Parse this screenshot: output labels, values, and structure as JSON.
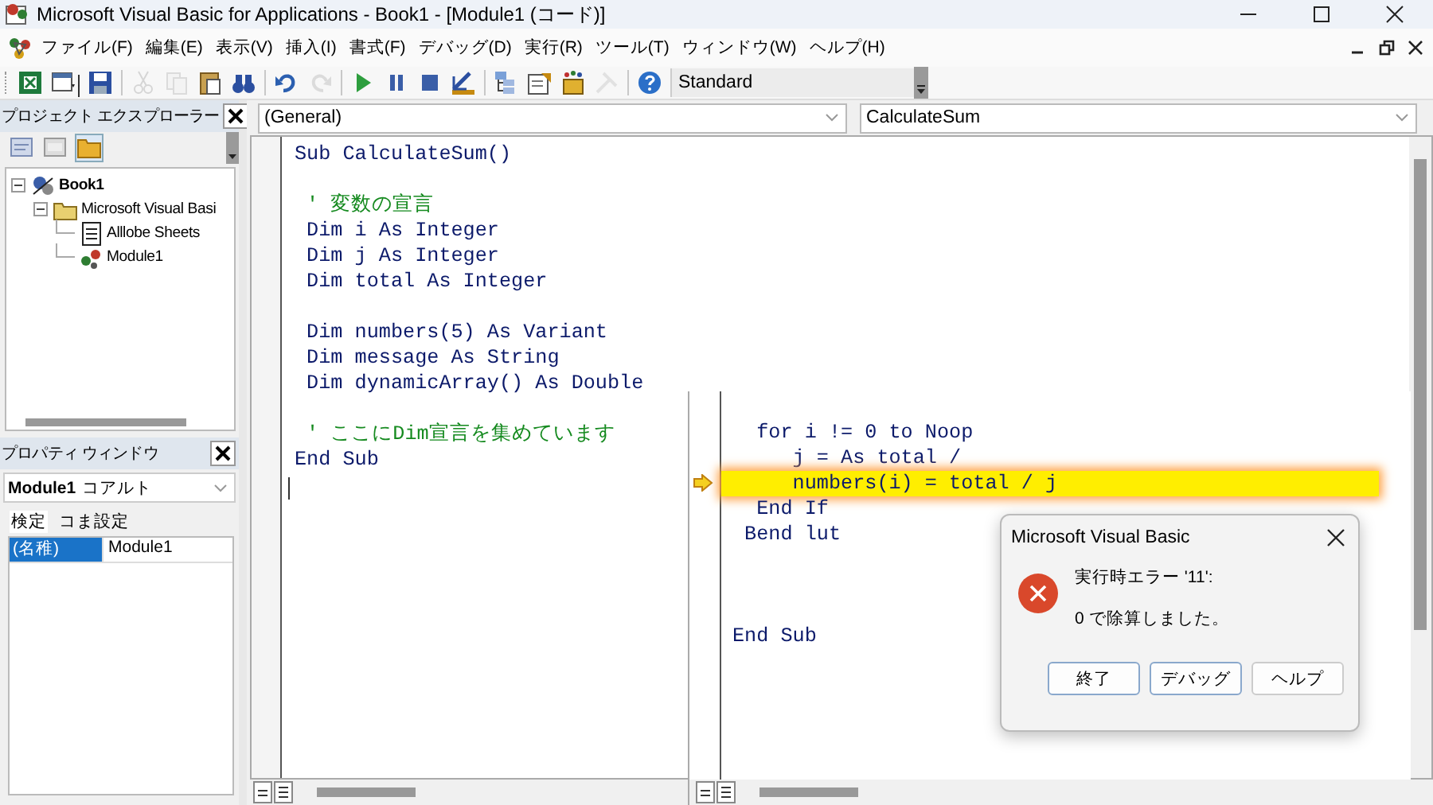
{
  "window": {
    "title": "Microsoft Visual Basic for Applications - Book1 - [Module1 (コード)]"
  },
  "menu": [
    "ファイル(F)",
    "編集(E)",
    "表示(V)",
    "挿入(I)",
    "書式(F)",
    "デバッグ(D)",
    "実行(R)",
    "ツール(T)",
    "ウィンドウ(W)",
    "ヘルプ(H)"
  ],
  "toolbar": {
    "buttons": [
      {
        "kind": "excel",
        "disabled": false
      },
      {
        "kind": "form",
        "disabled": false
      },
      {
        "kind": "save",
        "disabled": false
      },
      {
        "kind": "separator"
      },
      {
        "kind": "cut",
        "disabled": true
      },
      {
        "kind": "copy",
        "disabled": true
      },
      {
        "kind": "paste",
        "disabled": false
      },
      {
        "kind": "find",
        "disabled": false
      },
      {
        "kind": "separator"
      },
      {
        "kind": "undo",
        "disabled": false
      },
      {
        "kind": "redo",
        "disabled": true
      },
      {
        "kind": "separator"
      },
      {
        "kind": "run",
        "disabled": false
      },
      {
        "kind": "pause",
        "disabled": false
      },
      {
        "kind": "stop",
        "disabled": false
      },
      {
        "kind": "design",
        "disabled": false
      },
      {
        "kind": "separator"
      },
      {
        "kind": "project",
        "disabled": false
      },
      {
        "kind": "properties",
        "disabled": false
      },
      {
        "kind": "objects",
        "disabled": false
      },
      {
        "kind": "toolbox",
        "disabled": true
      },
      {
        "kind": "separator"
      },
      {
        "kind": "help",
        "disabled": false
      }
    ],
    "combo": "Standard"
  },
  "project_explorer": {
    "title": "プロジェクト エクスプローラー",
    "buttons": [
      {
        "kind": "code",
        "selected": false
      },
      {
        "kind": "object",
        "selected": false
      },
      {
        "kind": "folders",
        "selected": true
      }
    ],
    "tree": [
      {
        "label": "Book1",
        "kind": "project",
        "expanded": true,
        "children": [
          {
            "label": "Microsoft Visual Basi",
            "kind": "folder",
            "expanded": true,
            "children": [
              {
                "label": "Alllobe Sheets",
                "kind": "sheet"
              },
              {
                "label": "Module1",
                "kind": "module"
              }
            ]
          }
        ]
      }
    ]
  },
  "properties": {
    "title": "プロパティ ウィンドウ",
    "object_name": "Module1",
    "object_type": "コアルト",
    "tabs": [
      {
        "label": "検定",
        "selected": true
      },
      {
        "label": "コま設定",
        "selected": false
      }
    ],
    "rows": [
      {
        "name": "(名稚)",
        "value": "Module1",
        "selected": true
      }
    ]
  },
  "code_window": {
    "object": "(General)",
    "procedure": "CalculateSum",
    "lines": [
      {
        "kind": "code",
        "text": "Sub CalculateSum()"
      },
      {
        "kind": "blank"
      },
      {
        "kind": "comment",
        "text": " ' 変数の宣言"
      },
      {
        "kind": "code",
        "text": " Dim i As Integer"
      },
      {
        "kind": "code",
        "text": " Dim j As Integer"
      },
      {
        "kind": "code",
        "text": " Dim total As Integer"
      },
      {
        "kind": "blank"
      },
      {
        "kind": "code",
        "text": " Dim numbers(5) As Variant"
      },
      {
        "kind": "code",
        "text": " Dim message As String"
      },
      {
        "kind": "code",
        "text": " Dim dynamicArray() As Double"
      },
      {
        "kind": "blank"
      },
      {
        "kind": "comment",
        "text": " ' ここにDim宣言を集めています"
      },
      {
        "kind": "code",
        "text": "End Sub"
      }
    ],
    "second_pane": [
      {
        "kind": "code",
        "text": "  for i != 0 to Noop",
        "current": false
      },
      {
        "kind": "code",
        "text": "     j = As total /",
        "current": false
      },
      {
        "kind": "code",
        "text": "     numbers(i) = total / j",
        "current": true
      },
      {
        "kind": "code",
        "text": "  End If",
        "current": false
      },
      {
        "kind": "code",
        "text": " Bend lut",
        "current": false
      },
      {
        "kind": "blank",
        "current": false
      },
      {
        "kind": "blank",
        "current": false
      },
      {
        "kind": "blank",
        "current": false
      },
      {
        "kind": "code",
        "text": "End Sub",
        "current": false
      }
    ]
  },
  "dialog": {
    "title": "Microsoft Visual Basic",
    "error": "実行時エラー '11':",
    "message": "0 で除算しました。",
    "buttons": [
      "終了",
      "デバッグ",
      "ヘルプ"
    ]
  }
}
